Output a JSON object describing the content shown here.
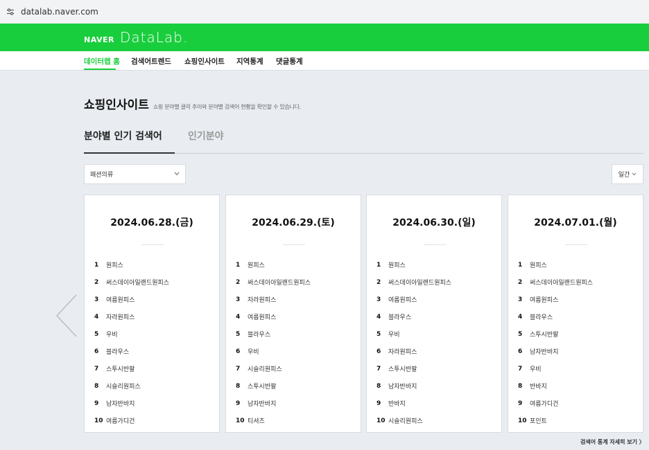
{
  "browser": {
    "url": "datalab.naver.com"
  },
  "header": {
    "logo_naver": "NAVER",
    "logo_datalab": "DataLab."
  },
  "nav": {
    "items": [
      "데이터랩 홈",
      "검색어트렌드",
      "쇼핑인사이트",
      "지역통계",
      "댓글통계"
    ],
    "active": "데이터랩 홈"
  },
  "page": {
    "title": "쇼핑인사이트",
    "subtitle": "쇼핑 분야별 클릭 추이와 분야별 검색어 현황을 확인할 수 있습니다."
  },
  "tabs": {
    "active": "분야별 인기 검색어",
    "inactive": "인기분야"
  },
  "filters": {
    "category": "패션의류",
    "period": "일간"
  },
  "cards": [
    {
      "date": "2024.06.28.(금)",
      "items": [
        "원피스",
        "써스데이아일랜드원피스",
        "여름원피스",
        "자라원피스",
        "우비",
        "블라우스",
        "스투시반팔",
        "시슬리원피스",
        "남자반바지",
        "여름가디건"
      ]
    },
    {
      "date": "2024.06.29.(토)",
      "items": [
        "원피스",
        "써스데이아일랜드원피스",
        "자라원피스",
        "여름원피스",
        "블라우스",
        "우비",
        "시슬리원피스",
        "스투시반팔",
        "남자반바지",
        "티셔츠"
      ]
    },
    {
      "date": "2024.06.30.(일)",
      "items": [
        "원피스",
        "써스데이아일랜드원피스",
        "여름원피스",
        "블라우스",
        "우비",
        "자라원피스",
        "스투시반팔",
        "남자반바지",
        "반바지",
        "시슬리원피스"
      ]
    },
    {
      "date": "2024.07.01.(월)",
      "items": [
        "원피스",
        "써스데이아일랜드원피스",
        "여름원피스",
        "블라우스",
        "스투시반팔",
        "남자반바지",
        "우비",
        "반바지",
        "여름가디건",
        "포인트"
      ]
    }
  ],
  "footer": {
    "more_link": "검색어 통계 자세히 보기 〉"
  },
  "colors": {
    "brand_green": "#19ce3c",
    "background": "#e9edf2"
  }
}
